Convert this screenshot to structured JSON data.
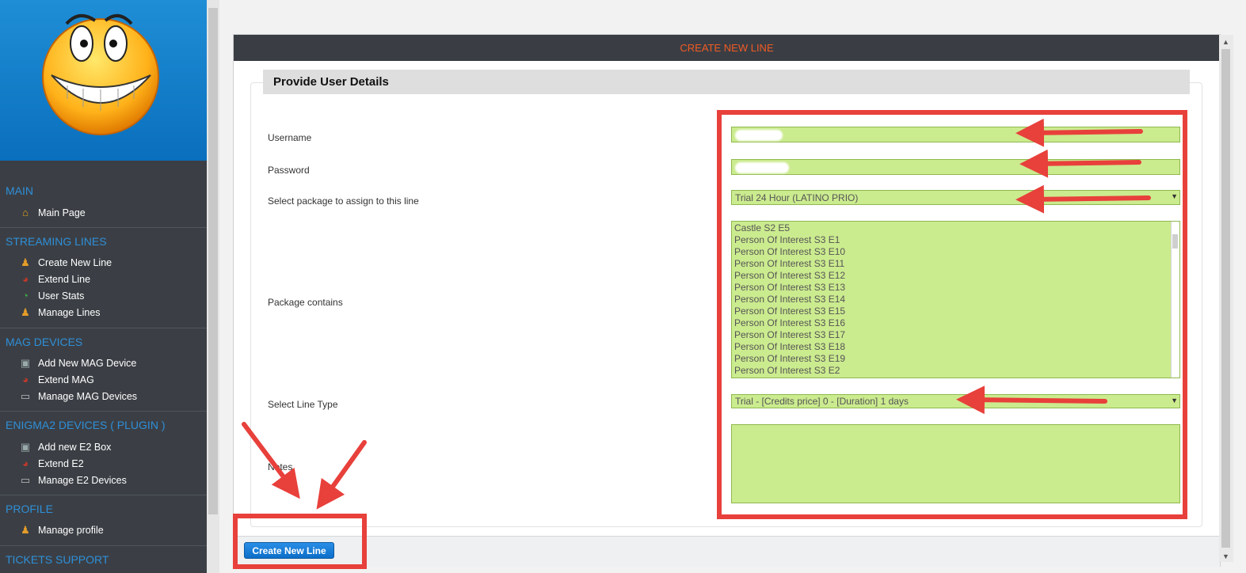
{
  "sidebar": {
    "sections": [
      {
        "title": "MAIN",
        "items": [
          {
            "label": "Main Page",
            "icon": "house-icon"
          }
        ]
      },
      {
        "title": "STREAMING LINES",
        "items": [
          {
            "label": "Create New Line",
            "icon": "add-user-icon"
          },
          {
            "label": "Extend Line",
            "icon": "clock-icon"
          },
          {
            "label": "User Stats",
            "icon": "pie-chart-icon"
          },
          {
            "label": "Manage Lines",
            "icon": "user-edit-icon"
          }
        ]
      },
      {
        "title": "MAG DEVICES",
        "items": [
          {
            "label": "Add New MAG Device",
            "icon": "add-device-icon"
          },
          {
            "label": "Extend MAG",
            "icon": "clock-icon"
          },
          {
            "label": "Manage MAG Devices",
            "icon": "device-icon"
          }
        ]
      },
      {
        "title": "ENIGMA2 DEVICES ( PLUGIN )",
        "items": [
          {
            "label": "Add new E2 Box",
            "icon": "add-device-icon"
          },
          {
            "label": "Extend E2",
            "icon": "clock-icon"
          },
          {
            "label": "Manage E2 Devices",
            "icon": "device-icon"
          }
        ]
      },
      {
        "title": "PROFILE",
        "items": [
          {
            "label": "Manage profile",
            "icon": "user-edit-icon"
          }
        ]
      },
      {
        "title": "TICKETS SUPPORT",
        "items": []
      }
    ]
  },
  "panel": {
    "header": "CREATE NEW LINE",
    "legend": "Provide User Details"
  },
  "form": {
    "username_label": "Username",
    "password_label": "Password",
    "package_label": "Select package to assign to this line",
    "package_value": "Trial 24 Hour (LATINO PRIO)",
    "contains_label": "Package contains",
    "contains": [
      "Castle S2 E5",
      "Person Of Interest S3 E1",
      "Person Of Interest S3 E10",
      "Person Of Interest S3 E11",
      "Person Of Interest S3 E12",
      "Person Of Interest S3 E13",
      "Person Of Interest S3 E14",
      "Person Of Interest S3 E15",
      "Person Of Interest S3 E16",
      "Person Of Interest S3 E17",
      "Person Of Interest S3 E18",
      "Person Of Interest S3 E19",
      "Person Of Interest S3 E2"
    ],
    "line_type_label": "Select Line Type",
    "line_type_value": "Trial - [Credits price] 0 - [Duration] 1 days",
    "notes_label": "Notes",
    "notes_value": ""
  },
  "buttons": {
    "create": "Create New Line"
  },
  "colors": {
    "accent": "#f15a24",
    "field_bg": "#cbeb8f",
    "annotation": "#e8403b",
    "nav_title": "#2f8fd8"
  }
}
